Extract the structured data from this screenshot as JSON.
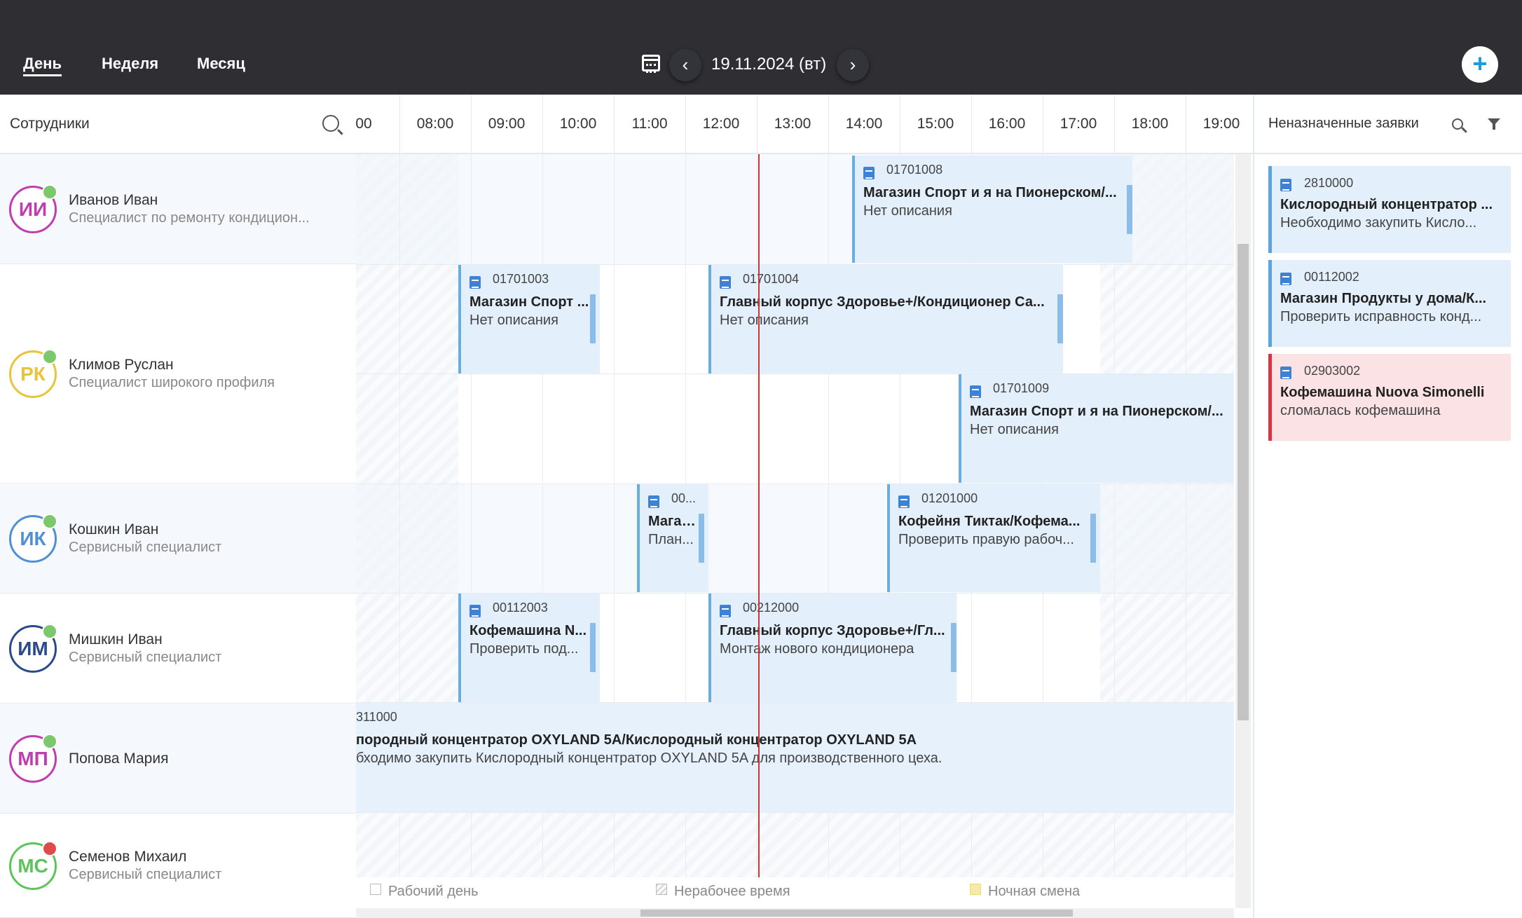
{
  "toolbar": {
    "tabs": [
      "День",
      "Неделя",
      "Месяц"
    ],
    "active_tab": "День",
    "date": "19.11.2024 (вт)",
    "prev_icon": "chevron-left-icon",
    "next_icon": "chevron-right-icon",
    "calendar_icon": "calendar-icon",
    "add_label": "+"
  },
  "employees_panel": {
    "title": "Сотрудники",
    "search_icon": "search-icon"
  },
  "timeline": {
    "hours": [
      "00",
      "08:00",
      "09:00",
      "10:00",
      "11:00",
      "12:00",
      "13:00",
      "14:00",
      "15:00",
      "16:00",
      "17:00",
      "18:00",
      "19:00"
    ]
  },
  "employees": [
    {
      "initials": "ИИ",
      "name": "Иванов Иван",
      "role": "Специалист по ремонту кондицион...",
      "color": "#c13cb0",
      "status": "available",
      "status_color": "#7cc86d"
    },
    {
      "initials": "РК",
      "name": "Климов Руслан",
      "role": "Специалист широкого профиля",
      "color": "#e8c43a",
      "status": "available",
      "status_color": "#7cc86d"
    },
    {
      "initials": "ИК",
      "name": "Кошкин Иван",
      "role": "Сервисный специалист",
      "color": "#4e8fd6",
      "status": "available",
      "status_color": "#7cc86d"
    },
    {
      "initials": "ИМ",
      "name": "Мишкин Иван",
      "role": "Сервисный специалист",
      "color": "#2a4a8c",
      "status": "available",
      "status_color": "#7cc86d"
    },
    {
      "initials": "МП",
      "name": "Попова Мария",
      "role": "",
      "color": "#c13cb0",
      "status": "available",
      "status_color": "#7cc86d"
    },
    {
      "initials": "МС",
      "name": "Семенов Михаил",
      "role": "Сервисный специалист",
      "color": "#5cc45a",
      "status": "busy",
      "status_color": "#e04a4a"
    }
  ],
  "events": [
    {
      "number": "01701008",
      "title": "Магазин Спорт и я на Пионерском/...",
      "desc": "Нет описания"
    },
    {
      "number": "01701003",
      "title": "Магазин Спорт ...",
      "desc": "Нет описания"
    },
    {
      "number": "01701004",
      "title": "Главный корпус Здоровье+/Кондиционер Са...",
      "desc": "Нет описания"
    },
    {
      "number": "01701009",
      "title": "Магазин Спорт и я на Пионерском/...",
      "desc": "Нет описания"
    },
    {
      "number": "00...",
      "title": "Магаз...",
      "desc": "План..."
    },
    {
      "number": "01201000",
      "title": "Кофейня Тиктак/Кофема...",
      "desc": "Проверить правую рабоч..."
    },
    {
      "number": "00112003",
      "title": "Кофемашина N...",
      "desc": "Проверить под..."
    },
    {
      "number": "00212000",
      "title": "Главный корпус Здоровье+/Гл...",
      "desc": "Монтаж нового кондиционера"
    },
    {
      "number": "311000",
      "title": "породный концентратор OXYLAND 5A/Кислородный концентратор OXYLAND 5A",
      "desc": "бходимо закупить Кислородный концентратор OXYLAND 5A для производственного цеха."
    }
  ],
  "legend": {
    "working_day": "Рабочий день",
    "non_working": "Нерабочее время",
    "night_shift": "Ночная смена"
  },
  "unassigned": {
    "title": "Неназначенные заявки",
    "search_icon": "search-icon",
    "filter_icon": "filter-icon",
    "cards": [
      {
        "number": "2810000",
        "title": "Кислородный концентратор ...",
        "desc": "Необходимо закупить Кисло...",
        "variant": "blue"
      },
      {
        "number": "00112002",
        "title": "Магазин Продукты у дома/К...",
        "desc": "Проверить исправность конд...",
        "variant": "blue"
      },
      {
        "number": "02903002",
        "title": "Кофемашина Nuova Simonelli",
        "desc": "сломалась кофемашина",
        "variant": "red"
      }
    ]
  },
  "colors": {
    "topbar": "#2e2e33",
    "accent": "#1e9be0",
    "now_line": "#c23a3a",
    "event_bg": "#e3effb",
    "event_border": "#6aaee0",
    "urgent_bg": "#fbe2e4",
    "urgent_border": "#d9343f"
  }
}
